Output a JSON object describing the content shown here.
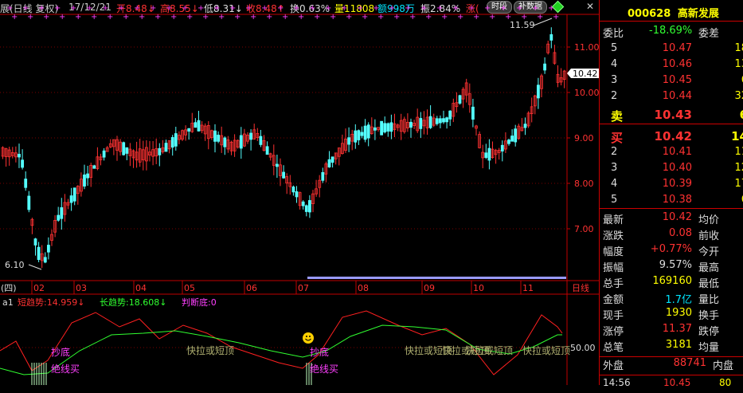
{
  "header": {
    "title": "展(日线 复权)",
    "date": "17/12/21",
    "open": "开8.48↓",
    "high": "高8.55↓",
    "low": "低8.31↓",
    "close": "收8.48↑",
    "turnover": "换0.63%",
    "volume": "量11808",
    "amount": "额998万",
    "amplitude": "振2.84%",
    "change": "涨(",
    "btn_period": "时段",
    "btn_fill": "补数据"
  },
  "price_axis": [
    "11.00",
    "10.00",
    "9.00",
    "8.00",
    "7.00"
  ],
  "current_price_tag": "10.42",
  "annotations": {
    "high": "11.59",
    "low": "6.10"
  },
  "month_axis": {
    "left_label": "(四)",
    "months": [
      "02",
      "03",
      "04",
      "05",
      "06",
      "07",
      "08",
      "09",
      "10",
      "11"
    ],
    "right_label": "日线"
  },
  "indicator": {
    "name": "a1",
    "short_trend": "短趋势:14.959↓",
    "long_trend": "长趋势:18.608↓",
    "judge_bottom": "判断底:0",
    "level_label": "50.00",
    "texts": [
      "抄底",
      "绝线买",
      "快拉或短顶",
      "抄底",
      "绝线买",
      "快拉或短顶",
      "快拉或短顶",
      "快拉或短顶",
      "快拉或短顶"
    ]
  },
  "stock": {
    "code": "000628",
    "name": "高新发展"
  },
  "quote": {
    "weibi_label": "委比",
    "weibi": "-18.69%",
    "weicha_label": "委差",
    "sells": [
      {
        "lvl": "5",
        "price": "10.47",
        "vol": "18"
      },
      {
        "lvl": "4",
        "price": "10.46",
        "vol": "13"
      },
      {
        "lvl": "3",
        "price": "10.45",
        "vol": "6"
      },
      {
        "lvl": "2",
        "price": "10.44",
        "vol": "32"
      },
      {
        "lvl": "卖",
        "price": "10.43",
        "vol": "6"
      }
    ],
    "buys": [
      {
        "lvl": "买",
        "price": "10.42",
        "vol": "14"
      },
      {
        "lvl": "2",
        "price": "10.41",
        "vol": "11"
      },
      {
        "lvl": "3",
        "price": "10.40",
        "vol": "12"
      },
      {
        "lvl": "4",
        "price": "10.39",
        "vol": "17"
      },
      {
        "lvl": "5",
        "price": "10.38",
        "vol": "6"
      }
    ],
    "stats": [
      {
        "label": "最新",
        "value": "10.42",
        "label2": "均价"
      },
      {
        "label": "涨跌",
        "value": "0.08",
        "label2": "前收"
      },
      {
        "label": "幅度",
        "value": "+0.77%",
        "label2": "今开"
      },
      {
        "label": "振幅",
        "value": "9.57%",
        "label2": "最高"
      },
      {
        "label": "总手",
        "value": "169160",
        "label2": "最低"
      },
      {
        "label": "金额",
        "value": "1.7亿",
        "label2": "量比"
      },
      {
        "label": "现手",
        "value": "1930",
        "label2": "换手"
      },
      {
        "label": "涨停",
        "value": "11.37",
        "label2": "跌停"
      },
      {
        "label": "总笔",
        "value": "3181",
        "label2": "均量"
      }
    ],
    "outer_label": "外盘",
    "outer_value": "88741",
    "inner_label": "内盘",
    "tick": {
      "time": "14:56",
      "price": "10.45",
      "vol": "80"
    }
  },
  "colors": {
    "up": "#ff3232",
    "down": "#54ffff",
    "axis": "#c00000",
    "short_line": "#ff2020",
    "long_line": "#30ff30"
  }
}
